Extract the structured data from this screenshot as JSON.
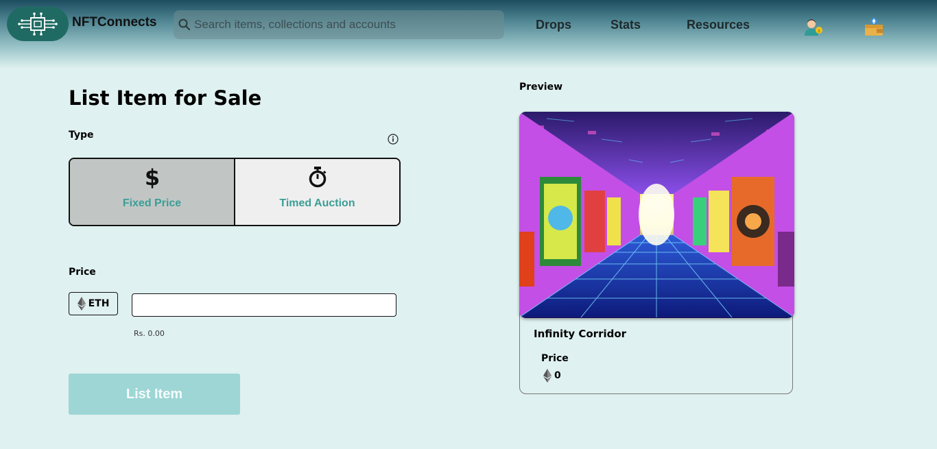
{
  "header": {
    "brand": "NFTConnects",
    "search_placeholder": "Search items, collections and accounts",
    "nav": [
      "Drops",
      "Stats",
      "Resources"
    ],
    "icons": [
      "circuit-logo-icon",
      "search-icon",
      "user-profile-icon",
      "wallet-icon"
    ]
  },
  "form": {
    "title": "List Item for Sale",
    "type_label": "Type",
    "types": [
      {
        "label": "Fixed Price",
        "icon": "dollar-icon",
        "selected": true
      },
      {
        "label": "Timed Auction",
        "icon": "stopwatch-icon",
        "selected": false
      }
    ],
    "price_label": "Price",
    "currency": "ETH",
    "price_value": "",
    "converted": "Rs. 0.00",
    "submit_label": "List Item"
  },
  "preview": {
    "heading": "Preview",
    "item_name": "Infinity Corridor",
    "price_label": "Price",
    "price_value": "0"
  },
  "colors": {
    "page_bg": "#dff1f0",
    "accent": "#3a9e96",
    "button_disabled": "#9dd6d5",
    "selected_option": "#c1c6c5"
  }
}
